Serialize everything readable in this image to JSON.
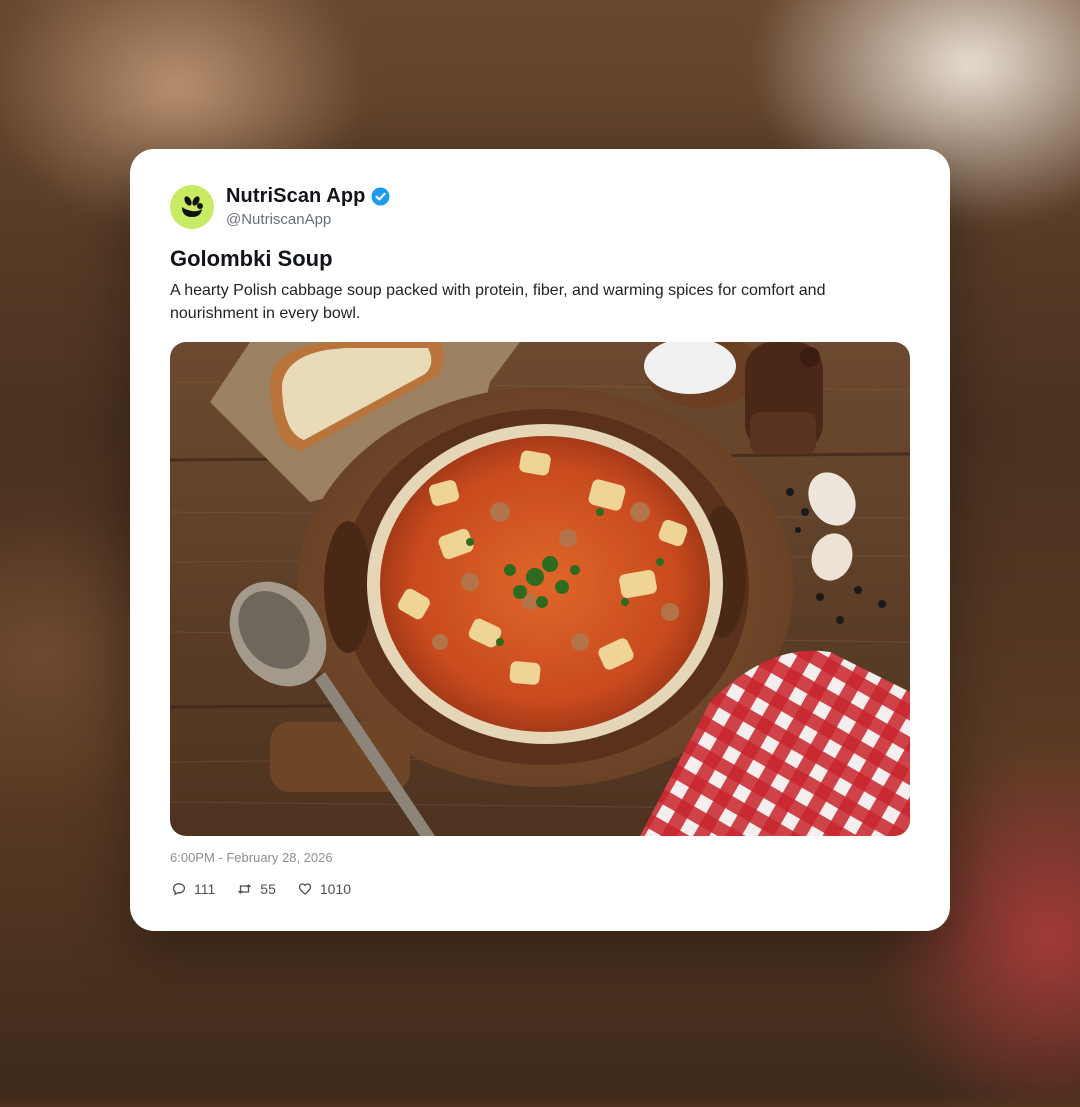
{
  "post": {
    "author": {
      "display_name": "NutriScan App",
      "handle": "@NutriscanApp",
      "verified": true,
      "avatar_icon": "nutriscan-logo-icon",
      "avatar_color": "#c9ea64",
      "verified_color": "#1d9bf0"
    },
    "title": "Golombki Soup",
    "body": "A hearty Polish cabbage soup packed with protein, fiber, and warming spices for comfort and nourishment in every bowl.",
    "image": {
      "subject": "golombki-soup-photo"
    },
    "timestamp": "6:00PM - February 28, 2026",
    "stats": {
      "replies": "111",
      "reposts": "55",
      "likes": "1010"
    }
  }
}
